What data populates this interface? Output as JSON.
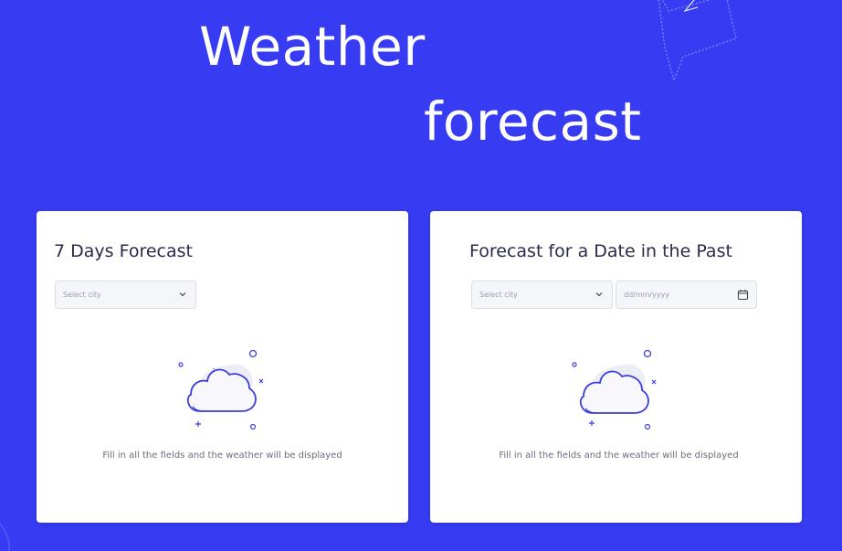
{
  "header": {
    "title_line1": "Weather",
    "title_line2": "forecast"
  },
  "colors": {
    "background": "#373cf3",
    "card": "#ffffff",
    "accent": "#3b3fd8"
  },
  "cards": {
    "seven_day": {
      "title": "7 Days Forecast",
      "city_select_placeholder": "Select city",
      "empty_hint": "Fill in all the fields and the weather will be displayed"
    },
    "past_date": {
      "title": "Forecast for a Date in the Past",
      "city_select_placeholder": "Select city",
      "date_placeholder": "dd/mm/yyyy",
      "empty_hint": "Fill in all the fields and the weather will be displayed"
    }
  },
  "icons": {
    "dropdown": "chevron-down-icon",
    "calendar": "calendar-icon",
    "illustration": "cloud-icon"
  }
}
